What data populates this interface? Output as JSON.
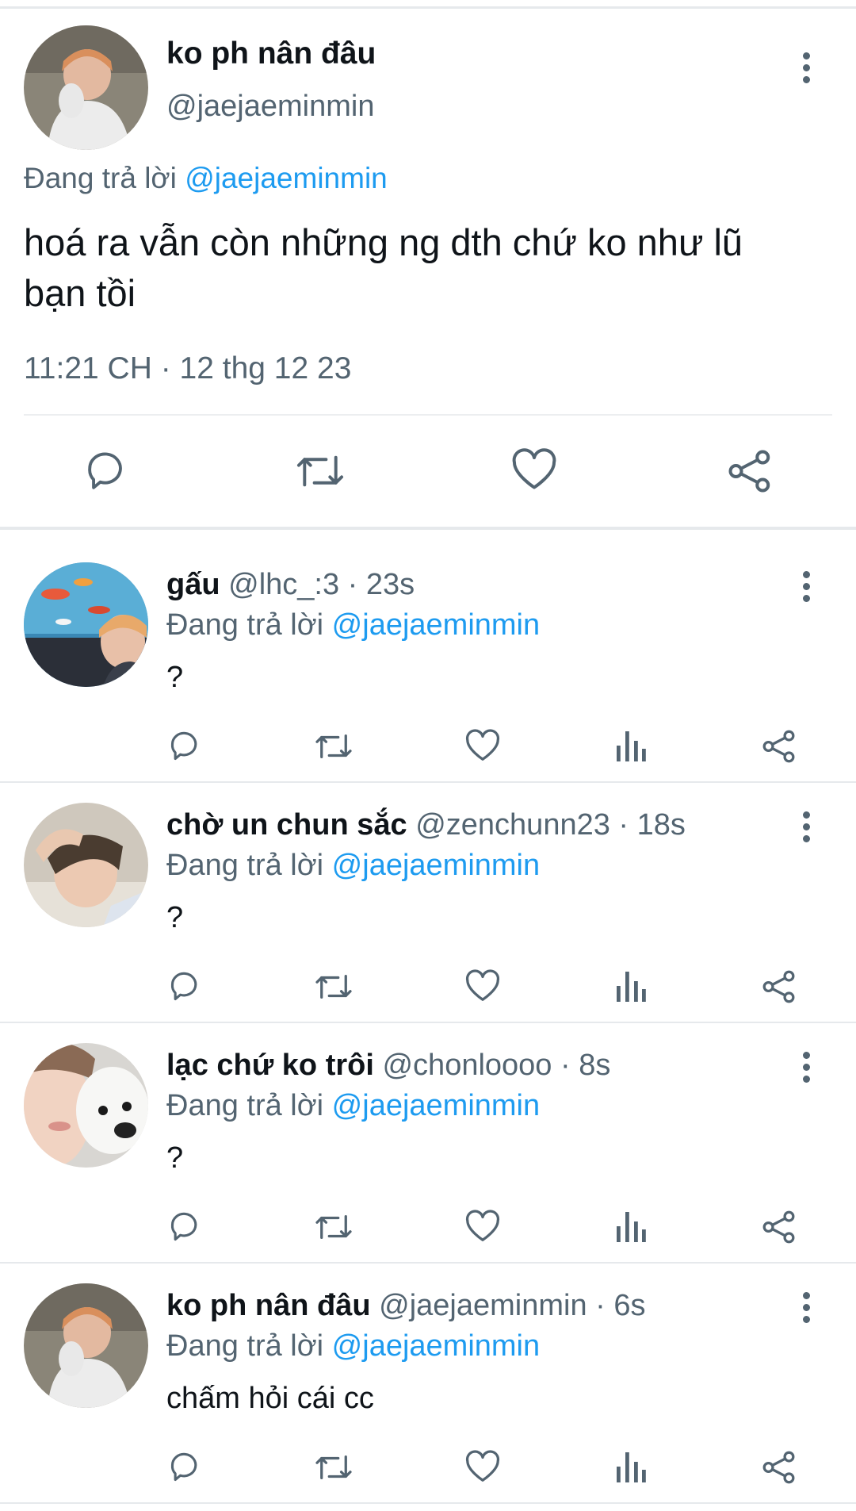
{
  "main_tweet": {
    "display_name": "ko ph nân đâu",
    "handle": "@jaejaeminmin",
    "replying_prefix": "Đang trả lời",
    "replying_handle": "@jaejaeminmin",
    "text_line1": "hoá ra vẫn còn những ng dth chứ ko như lũ",
    "text_line2": "bạn tồi",
    "timestamp": "11:21 CH · 12 thg 12 23"
  },
  "replies": [
    {
      "display_name": "gấu",
      "handle": "@lhc_:3",
      "time": "· 23s",
      "replying_prefix": "Đang trả lời",
      "replying_handle": "@jaejaeminmin",
      "text": "?"
    },
    {
      "display_name": "chờ un chun sắc",
      "handle": "@zenchunn23",
      "time": "· 18s",
      "replying_prefix": "Đang trả lời",
      "replying_handle": "@jaejaeminmin",
      "text": "?"
    },
    {
      "display_name": "lạc chứ ko trôi",
      "handle": "@chonloooo",
      "time": "· 8s",
      "replying_prefix": "Đang trả lời",
      "replying_handle": "@jaejaeminmin",
      "text": "?"
    },
    {
      "display_name": "ko ph nân đâu",
      "handle": "@jaejaeminmin",
      "time": "· 6s",
      "replying_prefix": "Đang trả lời",
      "replying_handle": "@jaejaeminmin",
      "text": "chấm hỏi cái cc"
    }
  ],
  "icons": {
    "reply": "reply-icon",
    "retweet": "retweet-icon",
    "like": "heart-icon",
    "views": "analytics-icon",
    "share": "share-icon",
    "more": "more-vertical-icon"
  },
  "colors": {
    "text": "#0f1419",
    "muted": "#536471",
    "link": "#1d9bf0",
    "divider": "#e6e9ec"
  }
}
